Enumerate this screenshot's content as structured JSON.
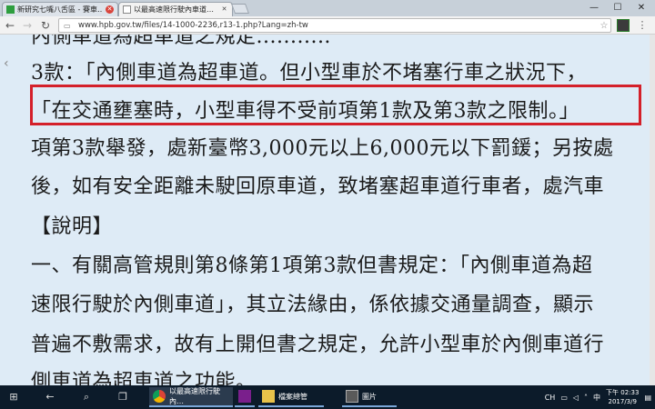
{
  "browser": {
    "tabs": [
      {
        "label": "新研究七嘴八舌區 - 賽車…",
        "close": "✕"
      },
      {
        "label": "以最高速限行駛內車道…",
        "close": "✕"
      }
    ],
    "url": "www.hpb.gov.tw/files/14-1000-2236,r13-1.php?Lang=zh-tw",
    "window_controls": {
      "minimize": "—",
      "maximize": "☐",
      "close": "✕"
    }
  },
  "page": {
    "lines": [
      "內側車道為超車道之規定...........",
      "3款：「內側車道為超車道。但小型車於不堵塞行車之狀況下，",
      "「在交通壅塞時，小型車得不受前項第1款及第3款之限制。」",
      "項第3款舉發，處新臺幣3,000元以上6,000元以下罰鍰；另按處",
      "後，如有安全距離未駛回原車道，致堵塞超車道行車者，處汽車",
      "【說明】",
      "一、有關高管規則第8條第1項第3款但書規定：「內側車道為超",
      "速限行駛於內側車道」，其立法緣由，係依據交通量調查，顯示",
      "普遍不敷需求，故有上開但書之規定，允許小型車於內側車道行",
      "側車道為超車道之功能。"
    ]
  },
  "taskbar": {
    "apps": [
      {
        "label": "以最高速限行駛內…"
      },
      {
        "label": ""
      },
      {
        "label": "檔案總管"
      },
      {
        "label": "圖片"
      }
    ],
    "tray": {
      "lang": "CH",
      "time": "下午 02:33",
      "date": "2017/3/9"
    }
  },
  "colors": {
    "page_bg": "#deebf6",
    "highlight": "#d4202a",
    "taskbar": "#0c1b2a"
  }
}
